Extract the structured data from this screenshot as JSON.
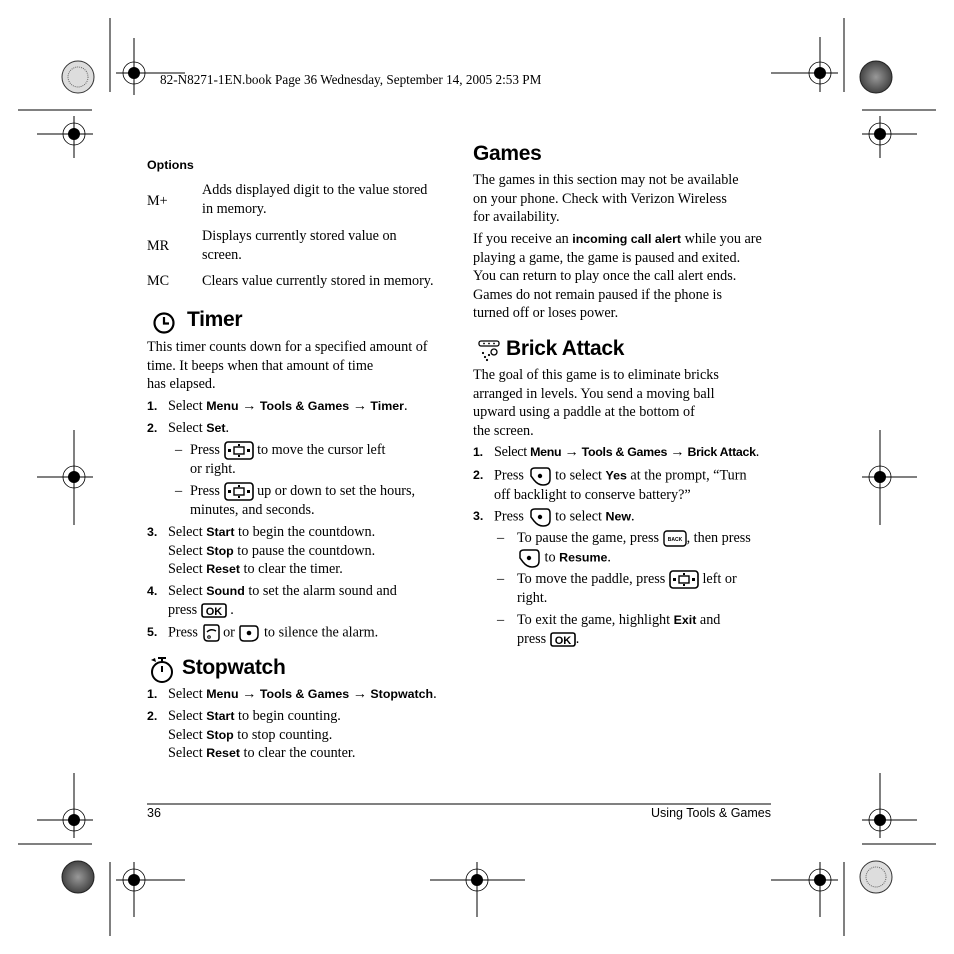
{
  "header": {
    "file_info": "82-N8271-1EN.book  Page 36  Wednesday, September 14, 2005  2:53 PM"
  },
  "footer": {
    "page_number": "36",
    "section_title": "Using Tools & Games"
  },
  "options": {
    "heading": "Options",
    "rows": [
      {
        "key": "M+",
        "description_lines": [
          "Adds displayed digit to the value stored",
          "in memory."
        ]
      },
      {
        "key": "MR",
        "description_lines": [
          "Displays currently stored value on",
          "screen."
        ]
      },
      {
        "key": "MC",
        "description_lines": [
          "Clears value currently stored in memory."
        ]
      }
    ]
  },
  "timer": {
    "icon": "clock-icon",
    "title": "Timer",
    "intro_lines": [
      "This timer counts down for a specified amount of",
      "time. It beeps when that amount of time",
      "has elapsed."
    ],
    "step1": {
      "num": "1.",
      "pre": "Select ",
      "menu": "Menu",
      "arrow": " → ",
      "tools": "Tools & Games",
      "arrow2": " → ",
      "item": "Timer",
      "end": "."
    },
    "step2": {
      "num": "2.",
      "pre": "Select ",
      "bold": "Set",
      "end": "."
    },
    "sub1": {
      "dash": "–",
      "pre": "Press ",
      "key": "nav-key",
      "post": " to move the cursor left",
      "line2": "or right."
    },
    "sub2": {
      "dash": "–",
      "pre": "Press ",
      "key": "nav-key",
      "post": " up or down to set the hours,",
      "line2": "minutes, and seconds."
    },
    "step3": {
      "num": "3.",
      "lines": [
        {
          "pre": "Select ",
          "bold": "Start",
          "post": " to begin the countdown."
        },
        {
          "pre": "Select ",
          "bold": "Stop",
          "post": " to pause the countdown."
        },
        {
          "pre": "Select ",
          "bold": "Reset",
          "post": " to clear the timer."
        }
      ]
    },
    "step4": {
      "num": "4.",
      "pre": "Select ",
      "bold": "Sound",
      "post": " to set the alarm sound and",
      "line2_pre": "press ",
      "key": "ok-key",
      "line2_post": " ."
    },
    "step5": {
      "num": "5.",
      "pre": "Press ",
      "key1": "left-softkey",
      "mid": " or ",
      "key2": "right-softkey",
      "post": " to silence the alarm."
    }
  },
  "stopwatch": {
    "icon": "stopwatch-icon",
    "title": "Stopwatch",
    "step1": {
      "num": "1.",
      "pre": "Select ",
      "menu": "Menu",
      "arrow": " → ",
      "tools": "Tools & Games",
      "arrow2": " → ",
      "item": "Stopwatch",
      "end": "."
    },
    "step2": {
      "num": "2.",
      "lines": [
        {
          "pre": "Select ",
          "bold": "Start",
          "post": " to begin counting."
        },
        {
          "pre": "Select ",
          "bold": "Stop",
          "post": " to stop counting."
        },
        {
          "pre": "Select ",
          "bold": "Reset",
          "post": " to clear the counter."
        }
      ]
    }
  },
  "games": {
    "title": "Games",
    "para1_lines": [
      "The games in this section may not be available",
      "on your phone. Check with Verizon Wireless",
      "for availability."
    ],
    "para2": {
      "pre": "If you receive an ",
      "bold": "incoming call alert",
      "post": " while you are"
    },
    "para2_lines": [
      "playing a game, the game is paused and exited.",
      "You can return to play once the call alert ends.",
      "Games do not remain paused if the phone is",
      "turned off or loses power."
    ]
  },
  "brick_attack": {
    "icon": "brick-attack-icon",
    "title": "Brick Attack",
    "intro_lines": [
      "The goal of this game is to eliminate bricks",
      "arranged in levels. You send a moving ball",
      "upward using a paddle at the bottom of",
      "the screen."
    ],
    "step1": {
      "num": "1.",
      "pre": "Select ",
      "menu": "Menu",
      "arrow": " → ",
      "tools": "Tools & Games",
      "arrow2": " → ",
      "item": "Brick Attack",
      "end": "."
    },
    "step2": {
      "num": "2.",
      "pre": "Press ",
      "key": "left-softkey",
      "post": " to select ",
      "bold": "Yes",
      "post2": " at the prompt, “Turn",
      "line2": "off backlight to conserve battery?”"
    },
    "step3": {
      "num": "3.",
      "pre": "Press ",
      "key": "left-softkey",
      "post": " to select ",
      "bold": "New",
      "end": "."
    },
    "sub1": {
      "dash": "–",
      "pre": "To pause the game, press ",
      "key": "back-key",
      "key_label": "BACK",
      "post": ", then press",
      "line2_key": "left-softkey",
      "line2_pre": " to ",
      "line2_bold": "Resume",
      "line2_end": "."
    },
    "sub2": {
      "dash": "–",
      "pre": "To move the paddle, press ",
      "key": "nav-key",
      "post": " left or",
      "line2": "right."
    },
    "sub3": {
      "dash": "–",
      "pre": "To exit the game, highlight ",
      "bold": "Exit",
      "post": " and",
      "line2_pre": "press ",
      "key": "ok-key",
      "line2_end": "."
    }
  },
  "keys": {
    "ok_label": "OK",
    "back_label": "BACK"
  }
}
